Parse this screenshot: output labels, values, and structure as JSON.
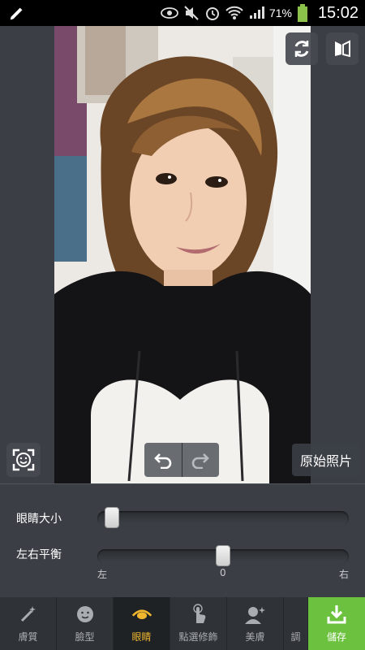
{
  "status_bar": {
    "battery_percent": "71%",
    "time": "15:02",
    "icons": [
      "pencil-icon",
      "eye-icon",
      "mute-icon",
      "alarm-icon",
      "wifi-icon",
      "signal-icon",
      "battery-icon"
    ]
  },
  "editor": {
    "original_photo_label": "原始照片",
    "tools": [
      "rotate-icon",
      "compare-icon",
      "face-detect-icon",
      "undo-icon",
      "redo-icon"
    ]
  },
  "sliders": {
    "eye_size": {
      "label": "眼睛大小",
      "value": 0.03
    },
    "balance": {
      "label": "左右平衡",
      "value": 0.5,
      "left_label": "左",
      "center_label": "0",
      "right_label": "右"
    }
  },
  "nav": {
    "items": [
      {
        "label": "膚質",
        "icon": "wand-icon"
      },
      {
        "label": "臉型",
        "icon": "face-icon"
      },
      {
        "label": "眼睛",
        "icon": "eye-icon",
        "active": true
      },
      {
        "label": "點選修飾",
        "icon": "tap-icon"
      },
      {
        "label": "美膚",
        "icon": "beauty-icon"
      },
      {
        "label": "調",
        "icon": "partial-icon"
      }
    ],
    "save_label": "儲存"
  },
  "colors": {
    "accent": "#f0b72e",
    "save_green": "#6cc23f",
    "panel_bg": "#3b3f45"
  }
}
